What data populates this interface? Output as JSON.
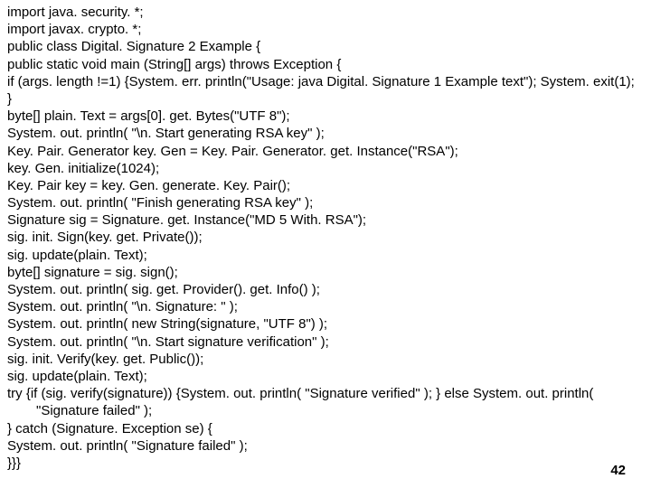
{
  "code": {
    "l01": "import java. security. *;",
    "l02": "import javax. crypto. *;",
    "l03": "public class Digital. Signature 2 Example {",
    "l04": "public static void main (String[] args) throws Exception {",
    "l05": "if (args. length !=1) {System. err. println(\"Usage: java Digital. Signature 1 Example text\"); System. exit(1); }",
    "l06": "byte[] plain. Text = args[0]. get. Bytes(\"UTF 8\");",
    "l07": "System. out. println( \"\\n. Start generating RSA key\" );",
    "l08": "Key. Pair. Generator key. Gen = Key. Pair. Generator. get. Instance(\"RSA\");",
    "l09": "key. Gen. initialize(1024);",
    "l10": "Key. Pair key = key. Gen. generate. Key. Pair();",
    "l11": "System. out. println( \"Finish generating RSA key\" );",
    "l12": "Signature sig = Signature. get. Instance(\"MD 5 With. RSA\");",
    "l13": "sig. init. Sign(key. get. Private());",
    "l14": "sig. update(plain. Text);",
    "l15": "byte[] signature = sig. sign();",
    "l16": "System. out. println( sig. get. Provider(). get. Info() );",
    "l17": "System. out. println( \"\\n. Signature: \" );",
    "l18": "System. out. println( new String(signature, \"UTF 8\") );",
    "l19": "System. out. println( \"\\n. Start signature verification\" );",
    "l20": "sig. init. Verify(key. get. Public());",
    "l21": "sig. update(plain. Text);",
    "l22": "try {if (sig. verify(signature)) {System. out. println( \"Signature verified\" ); } else System. out. println(",
    "l23": "\"Signature failed\" );",
    "l24": "} catch (Signature. Exception se) {",
    "l25": "System. out. println( \"Signature failed\" );",
    "l26": "}}}"
  },
  "page_number": "42"
}
